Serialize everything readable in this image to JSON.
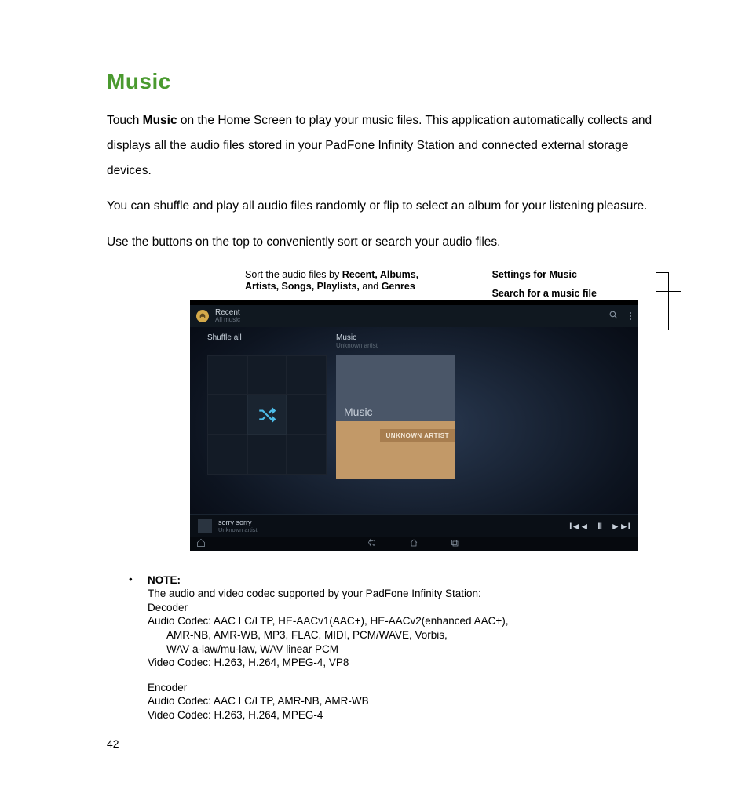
{
  "page_number": "42",
  "title": "Music",
  "paragraphs": {
    "p1a": "Touch ",
    "p1b": "Music",
    "p1c": " on the Home Screen to play your music files. This application automatically collects and displays all the audio files stored in your PadFone Infinity Station and connected external storage devices.",
    "p2": "You can shuffle and play all audio files randomly or flip to select an album for your listening pleasure.",
    "p3": "Use the buttons on the top to conveniently sort or search your audio files."
  },
  "callouts": {
    "sort_a": "Sort the audio files by ",
    "sort_b": "Recent, Albums, Artists, Songs, Playlists,",
    "sort_c": " and ",
    "sort_d": "Genres",
    "settings": "Settings for Music",
    "search": "Search for a music file"
  },
  "screenshot": {
    "header_title": "Recent",
    "header_subtitle": "All music",
    "shuffle_label": "Shuffle all",
    "album_header": "Music",
    "album_header_sub": "Unknown artist",
    "album_cover_title": "Music",
    "album_cover_artist": "UNKNOWN ARTIST",
    "now_playing_title": "sorry sorry",
    "now_playing_artist": "Unknown artist"
  },
  "note": {
    "heading": "NOTE:",
    "l1": "The audio and video codec supported by your PadFone Infinity Station:",
    "l2": "Decoder",
    "l3": "Audio Codec: AAC LC/LTP, HE-AACv1(AAC+), HE-AACv2(enhanced AAC+),",
    "l4": "AMR-NB, AMR-WB, MP3, FLAC, MIDI, PCM/WAVE, Vorbis,",
    "l5": "WAV a-law/mu-law, WAV linear PCM",
    "l6": "Video Codec: H.263, H.264, MPEG-4, VP8",
    "l7": "Encoder",
    "l8": "Audio Codec: AAC LC/LTP, AMR-NB, AMR-WB",
    "l9": "Video Codec: H.263, H.264, MPEG-4"
  }
}
